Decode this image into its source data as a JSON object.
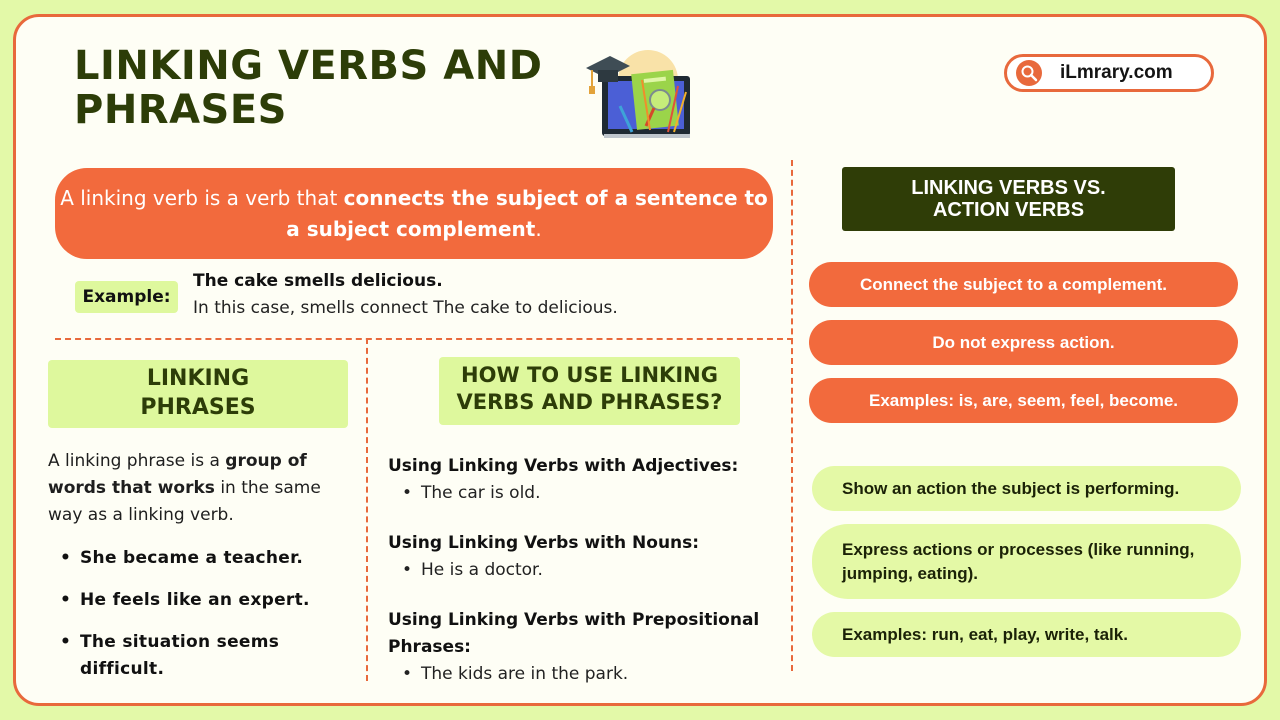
{
  "header": {
    "title_line1": "LINKING VERBS AND",
    "title_line2": "PHRASES",
    "illustration": "education-tablet-graduation-cap-illustration",
    "site": {
      "icon": "search-icon",
      "label": "iLmrary.com"
    }
  },
  "definition": {
    "prefix": "A linking verb is a verb that ",
    "bold": "connects the subject of a sentence to a subject complement",
    "suffix": "."
  },
  "example": {
    "badge": "Example:",
    "sentence": "The cake smells delicious.",
    "explanation": "In this case, smells connect The cake to delicious."
  },
  "linking_phrases": {
    "heading_line1": "LINKING",
    "heading_line2": "PHRASES",
    "def_prefix": "A linking phrase is a ",
    "def_bold": "group of words that works",
    "def_suffix": " in the same way as a linking verb.",
    "examples": [
      "She became a teacher.",
      "He feels like an expert.",
      "The situation seems difficult."
    ]
  },
  "how_to_use": {
    "heading_line1": "HOW TO USE LINKING",
    "heading_line2": "VERBS AND PHRASES?",
    "sections": [
      {
        "heading": "Using Linking Verbs with Adjectives:",
        "example": "The car is old."
      },
      {
        "heading": "Using Linking Verbs with Nouns:",
        "example": "He is a doctor."
      },
      {
        "heading": "Using Linking Verbs with Prepositional Phrases:",
        "example": "The kids are in the park."
      }
    ]
  },
  "comparison": {
    "heading_line1": "LINKING VERBS VS.",
    "heading_line2": "ACTION VERBS",
    "linking_points": [
      "Connect the subject to a complement.",
      "Do not express action.",
      "Examples: is, are, seem, feel, become."
    ],
    "action_points": [
      "Show an action the subject is performing.",
      "Express actions or processes (like running, jumping, eating).",
      "Examples: run, eat, play, write, talk."
    ]
  },
  "colors": {
    "background": "#e3f9a8",
    "card": "#fefef5",
    "accent_orange": "#f26a3d",
    "accent_green": "#def89d",
    "dark_olive": "#2f3d07"
  }
}
